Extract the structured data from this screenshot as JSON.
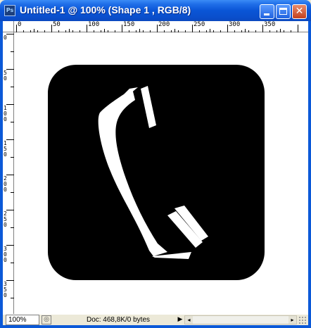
{
  "window": {
    "title": "Untitled-1 @ 100% (Shape 1 , RGB/8)",
    "app_icon_text": "Ps",
    "close_label": "✕"
  },
  "ruler": {
    "horizontal": [
      "0",
      "50",
      "100",
      "150",
      "200",
      "250",
      "300",
      "350"
    ],
    "vertical": [
      "0",
      "50",
      "100",
      "150",
      "200",
      "250",
      "300",
      "350"
    ]
  },
  "canvas": {
    "icon": "telephone-handset-icon",
    "shape_color": "#000000",
    "glyph_color": "#ffffff",
    "background": "#ffffff"
  },
  "status": {
    "zoom": "100%",
    "doc_info": "Doc: 468,8K/0 bytes",
    "arrow": "▶"
  },
  "colors": {
    "titlebar": "#0a55d6",
    "frame": "#0b59d8",
    "chrome": "#ece9d8"
  }
}
